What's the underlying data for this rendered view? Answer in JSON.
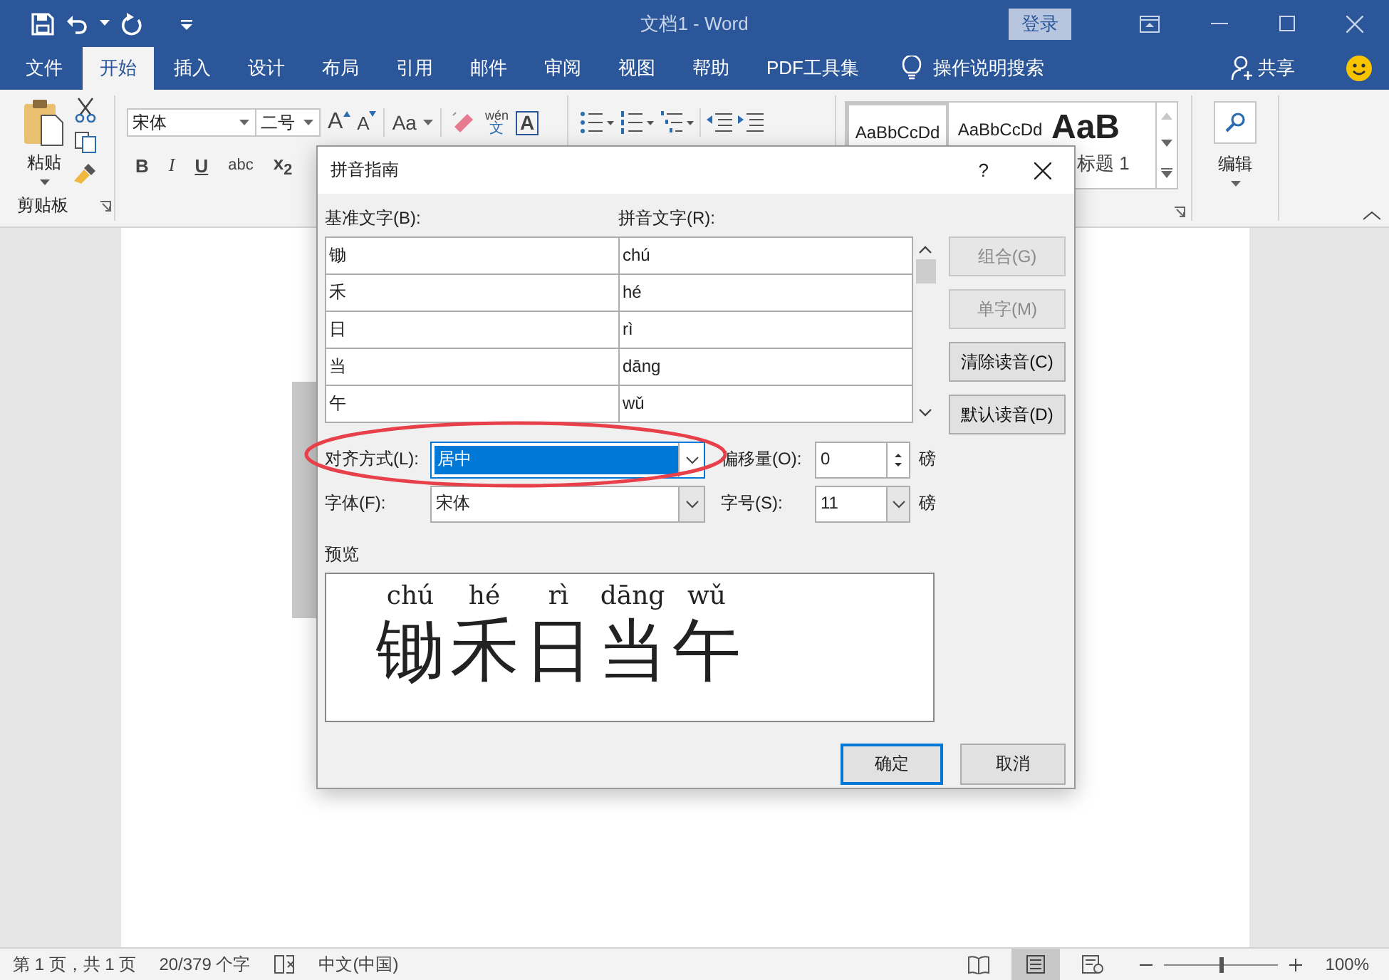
{
  "window": {
    "title": "文档1 - Word",
    "sign_in": "登录"
  },
  "tabs": [
    {
      "label": "文件",
      "selected": false
    },
    {
      "label": "开始",
      "selected": true
    },
    {
      "label": "插入",
      "selected": false
    },
    {
      "label": "设计",
      "selected": false
    },
    {
      "label": "布局",
      "selected": false
    },
    {
      "label": "引用",
      "selected": false
    },
    {
      "label": "邮件",
      "selected": false
    },
    {
      "label": "审阅",
      "selected": false
    },
    {
      "label": "视图",
      "selected": false
    },
    {
      "label": "帮助",
      "selected": false
    },
    {
      "label": "PDF工具集",
      "selected": false
    }
  ],
  "tell_me": "操作说明搜索",
  "share": "共享",
  "ribbon": {
    "paste": "粘贴",
    "clipboard_label": "剪贴板",
    "font_name": "宋体",
    "font_size": "二号",
    "grow": "A",
    "shrink": "A",
    "change_case": "Aa",
    "phonetic": {
      "ruby": "wén",
      "base": "文"
    },
    "char_border": "A",
    "format_buttons": [
      "B",
      "I",
      "U",
      "abc",
      "x$_{2}$"
    ],
    "styles": [
      {
        "sample": "AaBbCcDd",
        "kind": "normal",
        "selected": true
      },
      {
        "sample": "AaBbCcDd",
        "kind": "normal",
        "selected": false
      },
      {
        "sample": "AaB",
        "kind": "heading",
        "label": "标题 1",
        "selected": false
      }
    ],
    "editing": "编辑"
  },
  "dialog": {
    "title": "拼音指南",
    "help": "?",
    "base_label": "基准文字(B):",
    "ruby_label": "拼音文字(R):",
    "rows": [
      {
        "base": "锄",
        "ruby": "chú"
      },
      {
        "base": "禾",
        "ruby": "hé"
      },
      {
        "base": "日",
        "ruby": "rì"
      },
      {
        "base": "当",
        "ruby": "dāng"
      },
      {
        "base": "午",
        "ruby": "wǔ"
      }
    ],
    "buttons": [
      {
        "label": "组合(G)",
        "disabled": true
      },
      {
        "label": "单字(M)",
        "disabled": true
      },
      {
        "label": "清除读音(C)",
        "disabled": false
      },
      {
        "label": "默认读音(D)",
        "disabled": false
      }
    ],
    "alignment": {
      "label": "对齐方式(L):",
      "value": "居中"
    },
    "offset": {
      "label": "偏移量(O):",
      "value": "0",
      "unit": "磅"
    },
    "font": {
      "label": "字体(F):",
      "value": "宋体"
    },
    "size": {
      "label": "字号(S):",
      "value": "11",
      "unit": "磅"
    },
    "preview_label": "预览",
    "preview": [
      {
        "ruby": "chú",
        "base": "锄"
      },
      {
        "ruby": "hé",
        "base": "禾"
      },
      {
        "ruby": "rì",
        "base": "日"
      },
      {
        "ruby": "dāng",
        "base": "当"
      },
      {
        "ruby": "wǔ",
        "base": "午"
      }
    ],
    "ok": "确定",
    "cancel": "取消"
  },
  "status_bar": {
    "page": "第 1 页，共 1 页",
    "words": "20/379 个字",
    "language": "中文(中国)",
    "views": [
      {
        "kind": "read",
        "selected": false
      },
      {
        "kind": "print",
        "selected": true
      },
      {
        "kind": "web",
        "selected": false
      }
    ],
    "zoom": {
      "level": 0.5,
      "reading": "100%"
    }
  }
}
